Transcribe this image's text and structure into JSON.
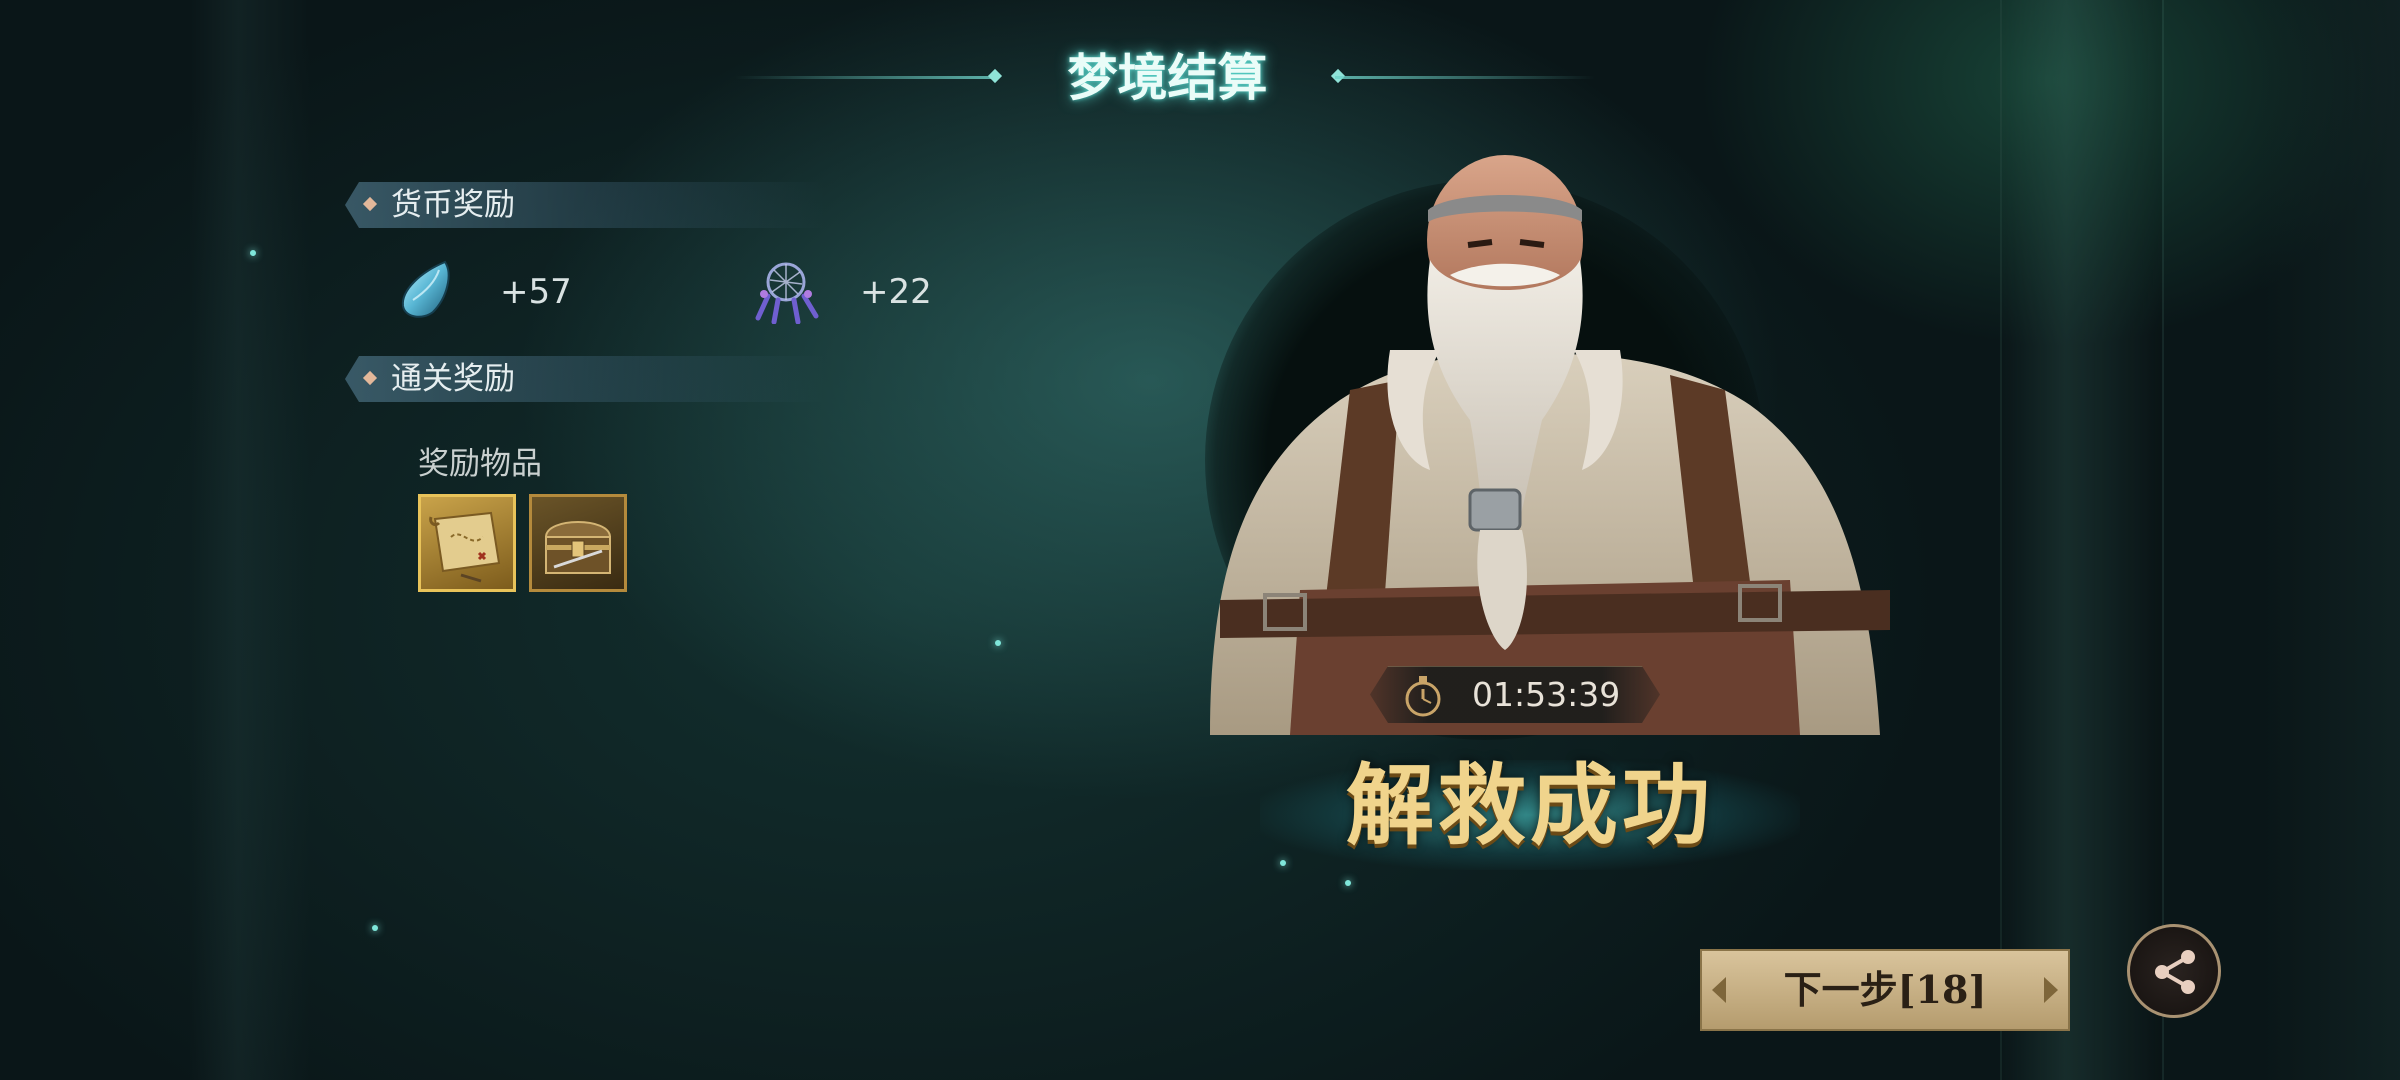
{
  "title": "梦境结算",
  "currency_section": {
    "label": "货币奖励",
    "items": [
      {
        "icon": "teal-crystal-icon",
        "value": "+57"
      },
      {
        "icon": "dreamcatcher-icon",
        "value": "+22"
      }
    ]
  },
  "clear_section": {
    "label": "通关奖励",
    "reward_label": "奖励物品",
    "items": [
      {
        "icon": "treasure-map-icon",
        "highlight": true
      },
      {
        "icon": "treasure-chest-icon",
        "highlight": false
      }
    ]
  },
  "result": {
    "time": "01:53:39",
    "status": "解救成功"
  },
  "next_button": {
    "label": "下一步[18]"
  },
  "share_button": {
    "icon": "share-icon"
  },
  "colors": {
    "title_glow": "#5adcd2",
    "gold_text": "#f0d48c",
    "button_bg": "#d9c49c"
  }
}
